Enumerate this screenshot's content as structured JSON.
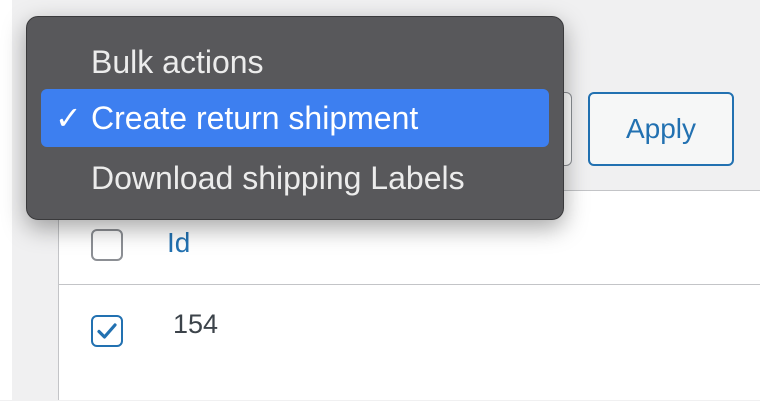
{
  "dropdown": {
    "items": [
      {
        "label": "Bulk actions",
        "selected": false
      },
      {
        "label": "Create return shipment",
        "selected": true
      },
      {
        "label": "Download shipping Labels",
        "selected": false
      }
    ],
    "check_glyph": "✓"
  },
  "toolbar": {
    "apply_label": "Apply"
  },
  "table": {
    "columns": [
      "Id"
    ],
    "rows": [
      {
        "id": "154",
        "checked": true
      }
    ],
    "header_checked": false
  },
  "colors": {
    "accent": "#2271b1",
    "menu_background": "#58585b",
    "menu_selected": "#3d7ff0"
  }
}
